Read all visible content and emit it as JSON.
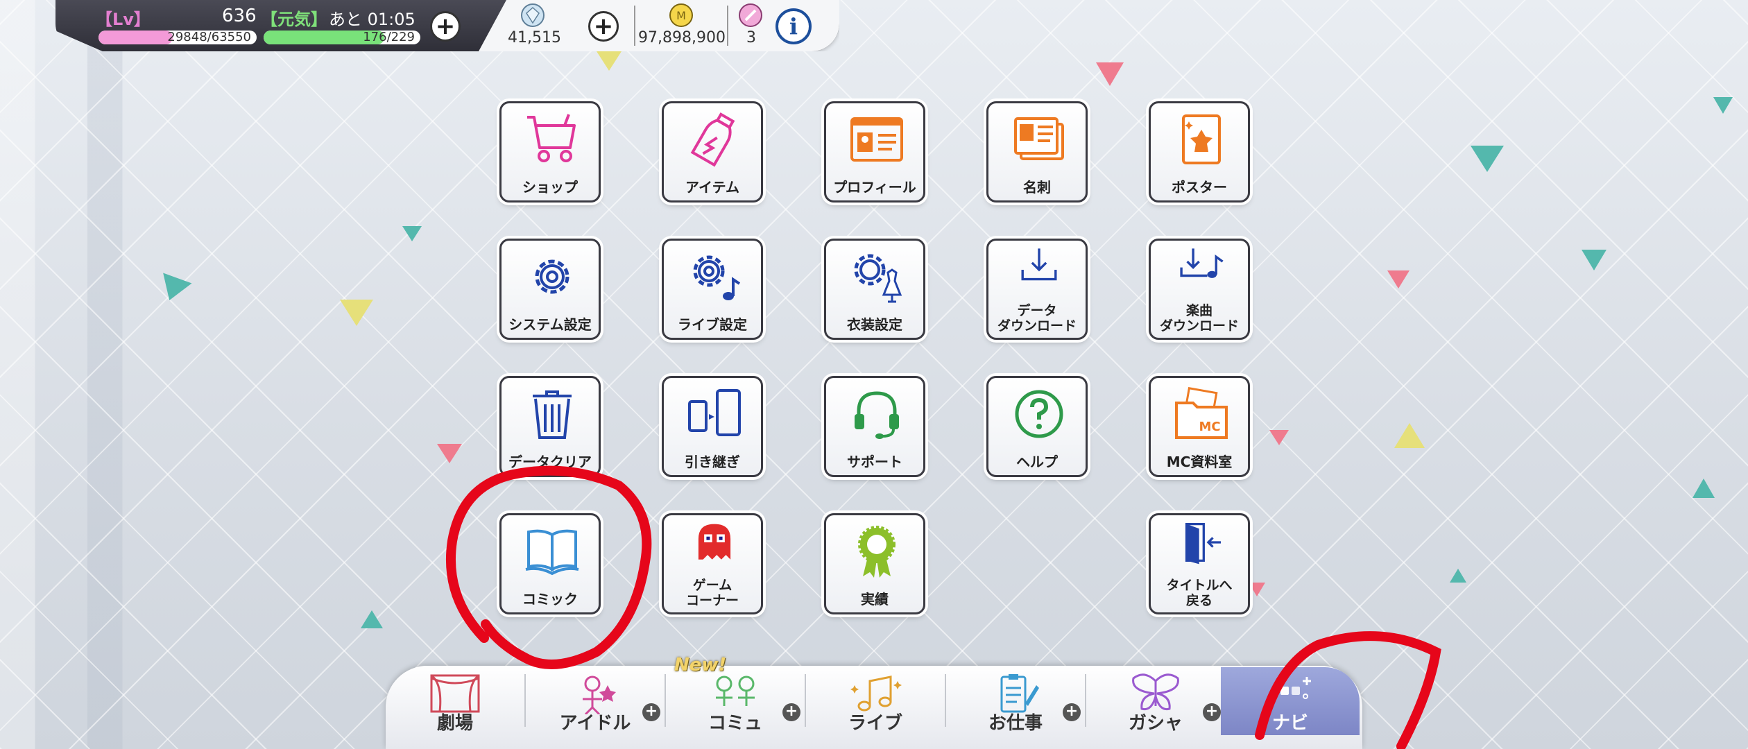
{
  "status": {
    "lv_label": "【Lv】",
    "lv_value": "636",
    "genki_label": "【元気】",
    "time_remaining": "あと 01:05",
    "exp": {
      "current": "29848",
      "max": "/63550",
      "fraction": 0.47
    },
    "stamina": {
      "current": "176",
      "max": "/229",
      "fraction": 0.77
    },
    "jewels": "41,515",
    "money": "97,898,900",
    "tickets": "3",
    "colors": {
      "exp_fill": "#f39ad8",
      "stamina_fill": "#79e27a",
      "lv": "#e37fd0",
      "genki": "#7fe07a"
    }
  },
  "menu": {
    "shop": "ショップ",
    "item": "アイテム",
    "profile": "プロフィール",
    "card": "名刺",
    "poster": "ポスター",
    "system": "システム設定",
    "live_settings": "ライブ設定",
    "costume": "衣装設定",
    "data_dl_1": "データ",
    "data_dl_2": "ダウンロード",
    "music_dl_1": "楽曲",
    "music_dl_2": "ダウンロード",
    "data_clear": "データクリア",
    "transfer": "引き継ぎ",
    "support": "サポート",
    "help": "ヘルプ",
    "mc_room": "MC資料室",
    "comic": "コミック",
    "game_1": "ゲーム",
    "game_2": "コーナー",
    "achievement": "実績",
    "title_1": "タイトルへ",
    "title_2": "戻る"
  },
  "nav": {
    "theater": "劇場",
    "idol": "アイドル",
    "commu": "コミュ",
    "live": "ライブ",
    "work": "お仕事",
    "gacha": "ガシャ",
    "navi": "ナビ",
    "new_badge": "New!"
  }
}
